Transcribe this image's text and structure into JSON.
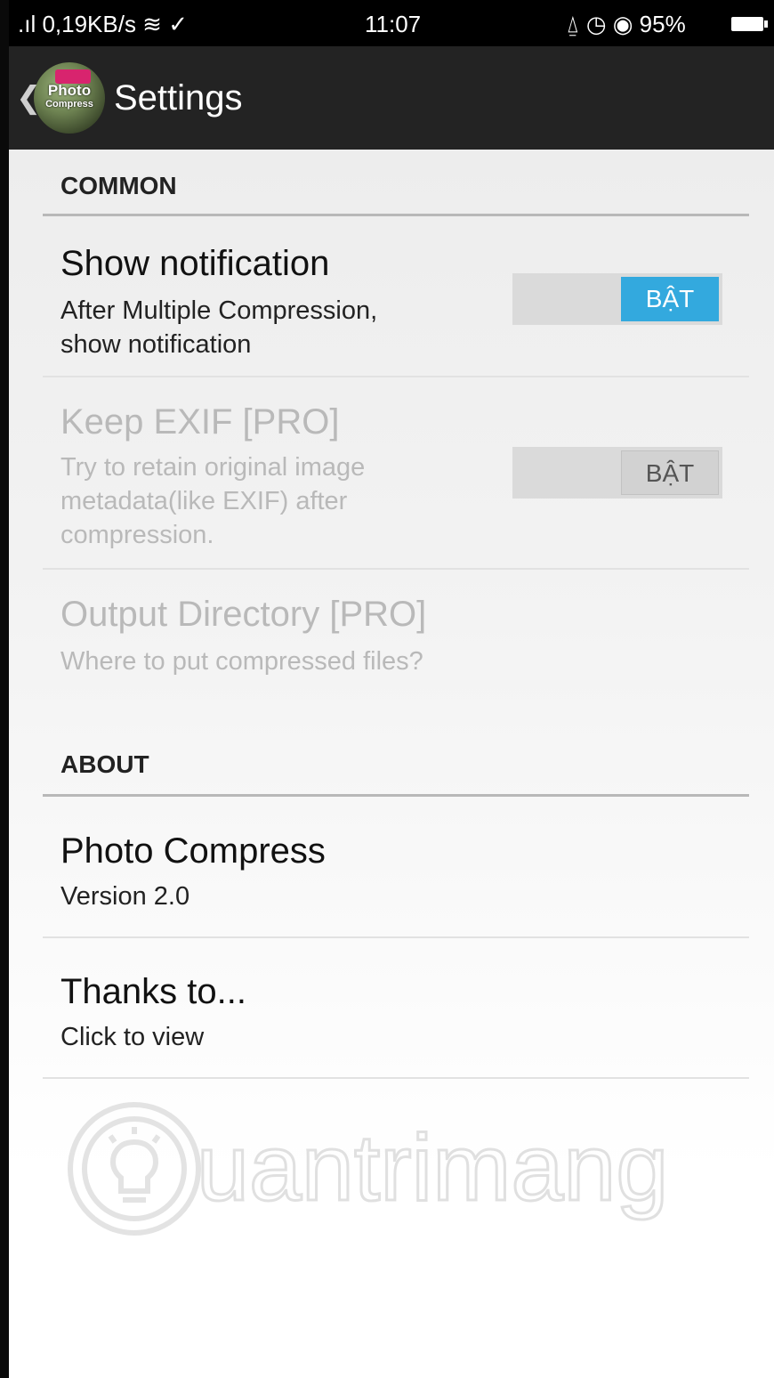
{
  "status_bar": {
    "signal_speed": ".ıl 0,19KB/s ≋ ✓",
    "time": "11:07",
    "indicators": "⍙ ◷ ◉ 95%",
    "battery_icon": "battery-icon"
  },
  "app_bar": {
    "back_icon": "chevron-left-icon",
    "logo_line1": "Photo",
    "logo_line2": "Compress",
    "title": "Settings"
  },
  "sections": {
    "common": {
      "header": "COMMON",
      "show_notification": {
        "title": "Show notification",
        "summary_line1": "After Multiple Compression,",
        "summary_line2": "show notification",
        "toggle_label": "BẬT",
        "enabled": true
      },
      "keep_exif": {
        "title": "Keep EXIF [PRO]",
        "summary_line1": "Try to retain original image",
        "summary_line2": "metadata(like EXIF) after",
        "summary_line3": "compression.",
        "toggle_label": "BẬT",
        "enabled": false
      },
      "output_directory": {
        "title": "Output Directory [PRO]",
        "summary": "Where to put compressed files?",
        "enabled": false
      }
    },
    "about": {
      "header": "ABOUT",
      "app_info": {
        "title": "Photo Compress",
        "summary": "Version 2.0"
      },
      "thanks": {
        "title": "Thanks to...",
        "summary": "Click to view"
      }
    }
  },
  "watermark": {
    "text": "uantrimang",
    "icon": "lightbulb-icon"
  },
  "colors": {
    "toggle_on": "#33a9de",
    "app_bar": "#232323",
    "disabled_text": "#b9b9b9"
  }
}
